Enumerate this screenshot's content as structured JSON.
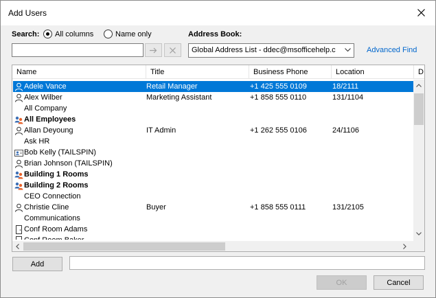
{
  "window": {
    "title": "Add Users"
  },
  "search": {
    "label": "Search:",
    "options": [
      {
        "label": "All columns",
        "checked": true
      },
      {
        "label": "Name only",
        "checked": false
      }
    ],
    "value": "",
    "go_icon": "arrow-right-icon",
    "clear_icon": "x-icon"
  },
  "address_book": {
    "label": "Address Book:",
    "selected": "Global Address List - ddec@msofficehelp.c",
    "advanced_find": "Advanced Find"
  },
  "list": {
    "columns": [
      "Name",
      "Title",
      "Business Phone",
      "Location",
      "D"
    ],
    "rows": [
      {
        "icon": "user",
        "name": "Adele Vance",
        "title": "Retail Manager",
        "phone": "+1 425 555 0109",
        "location": "18/2111",
        "selected": true
      },
      {
        "icon": "user",
        "name": "Alex Wilber",
        "title": "Marketing Assistant",
        "phone": "+1 858 555 0110",
        "location": "131/1104"
      },
      {
        "icon": "none",
        "name": "All Company",
        "title": "",
        "phone": "",
        "location": ""
      },
      {
        "icon": "group",
        "name": "All Employees",
        "title": "",
        "phone": "",
        "location": "",
        "bold": true
      },
      {
        "icon": "user",
        "name": "Allan Deyoung",
        "title": "IT Admin",
        "phone": "+1 262 555 0106",
        "location": "24/1106"
      },
      {
        "icon": "none",
        "name": "Ask HR",
        "title": "",
        "phone": "",
        "location": ""
      },
      {
        "icon": "contact",
        "name": "Bob Kelly (TAILSPIN)",
        "title": "",
        "phone": "",
        "location": ""
      },
      {
        "icon": "user",
        "name": "Brian Johnson (TAILSPIN)",
        "title": "",
        "phone": "",
        "location": ""
      },
      {
        "icon": "group",
        "name": "Building 1 Rooms",
        "title": "",
        "phone": "",
        "location": "",
        "bold": true
      },
      {
        "icon": "group",
        "name": "Building 2 Rooms",
        "title": "",
        "phone": "",
        "location": "",
        "bold": true
      },
      {
        "icon": "none",
        "name": "CEO Connection",
        "title": "",
        "phone": "",
        "location": ""
      },
      {
        "icon": "user",
        "name": "Christie Cline",
        "title": "Buyer",
        "phone": "+1 858 555 0111",
        "location": "131/2105"
      },
      {
        "icon": "none",
        "name": "Communications",
        "title": "",
        "phone": "",
        "location": ""
      },
      {
        "icon": "room",
        "name": "Conf Room Adams",
        "title": "",
        "phone": "",
        "location": ""
      },
      {
        "icon": "room",
        "name": "Conf Room Baker",
        "title": "",
        "phone": "",
        "location": ""
      }
    ]
  },
  "footer": {
    "add_label": "Add",
    "add_value": "",
    "ok_label": "OK",
    "cancel_label": "Cancel"
  },
  "colors": {
    "selection": "#0078d7",
    "link": "#0066cc",
    "group_icon_orange": "#e8632b",
    "group_icon_blue": "#3c6fb5"
  }
}
